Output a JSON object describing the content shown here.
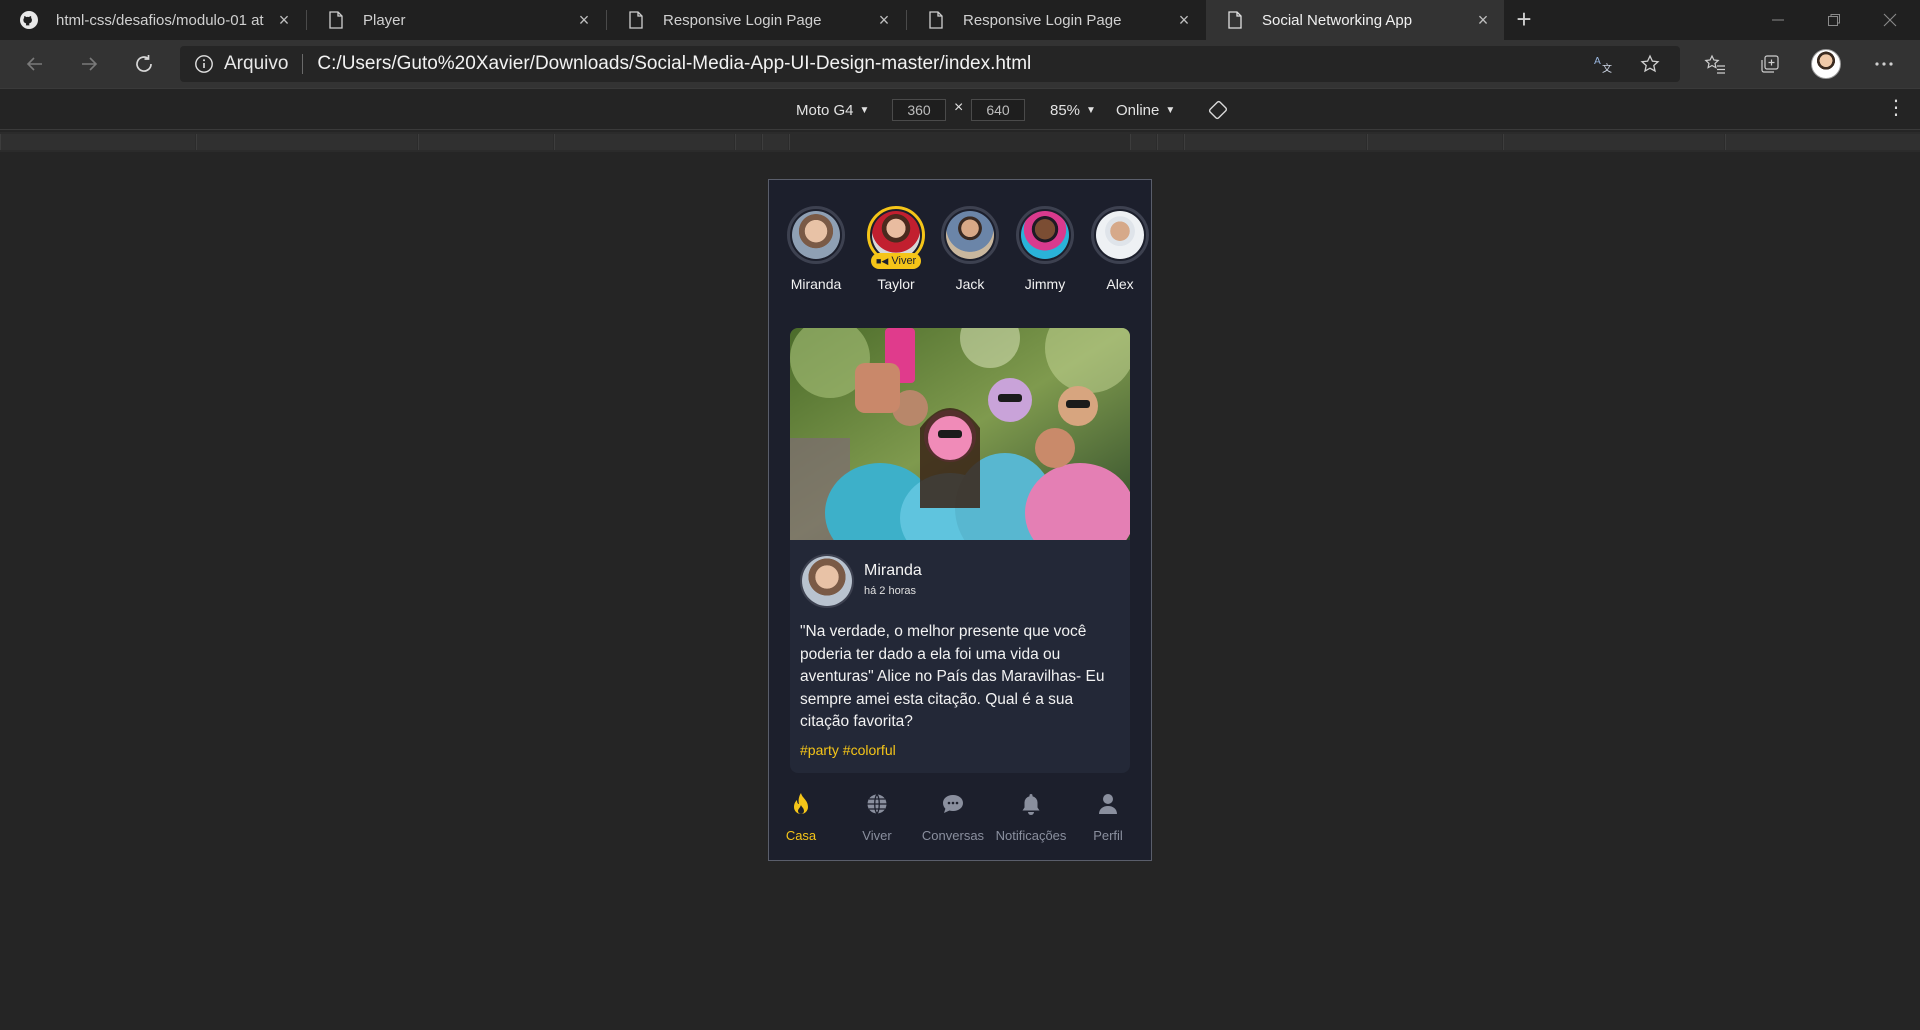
{
  "browser": {
    "tabs": [
      {
        "title": "html-css/desafios/modulo-01 at",
        "icon": "github-icon",
        "active": false
      },
      {
        "title": "Player",
        "icon": "page-icon",
        "active": false
      },
      {
        "title": "Responsive Login Page",
        "icon": "page-icon",
        "active": false
      },
      {
        "title": "Responsive Login Page",
        "icon": "page-icon",
        "active": false
      },
      {
        "title": "Social Networking App",
        "icon": "page-icon",
        "active": true
      }
    ],
    "address": {
      "scheme_label": "Arquivo",
      "url": "C:/Users/Guto%20Xavier/Downloads/Social-Media-App-UI-Design-master/index.html"
    }
  },
  "devtools": {
    "device": "Moto G4",
    "width": "360",
    "height": "640",
    "zoom": "85%",
    "throttle": "Online"
  },
  "app": {
    "accent_color": "#f5c518",
    "background_color": "#1c1f2c",
    "stories": [
      {
        "name": "Miranda",
        "live": false
      },
      {
        "name": "Taylor",
        "live": true,
        "badge": "Viver"
      },
      {
        "name": "Jack",
        "live": false
      },
      {
        "name": "Jimmy",
        "live": false
      },
      {
        "name": "Alex",
        "live": false
      }
    ],
    "post": {
      "author": "Miranda",
      "time": "há 2 horas",
      "text": "\"Na verdade, o melhor presente que você poderia ter dado a ela foi uma vida ou aventuras\" Alice no País das Maravilhas- Eu sempre amei esta citação. Qual é a sua citação favorita?",
      "tags": "#party #colorful"
    },
    "bottom_nav": [
      {
        "label": "Casa",
        "icon": "flame-icon",
        "active": true
      },
      {
        "label": "Viver",
        "icon": "globe-icon",
        "active": false
      },
      {
        "label": "Conversas",
        "icon": "chat-bubble-icon",
        "active": false
      },
      {
        "label": "Notificações",
        "icon": "bell-icon",
        "active": false
      },
      {
        "label": "Perfil",
        "icon": "user-icon",
        "active": false
      }
    ]
  }
}
